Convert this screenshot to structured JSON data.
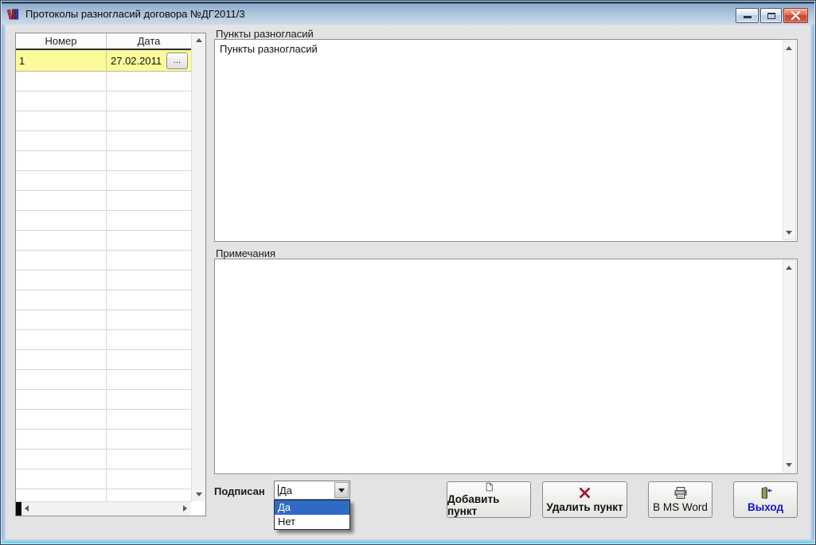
{
  "window": {
    "title": "Протоколы разногласий договора №ДГ2011/3"
  },
  "grid": {
    "columns": [
      "Номер",
      "Дата"
    ],
    "rows": [
      {
        "number": "1",
        "date": "27.02.2011"
      }
    ],
    "more_button": "...",
    "visible_empty_rows": 22
  },
  "sections": {
    "points": {
      "label": "Пункты разногласий",
      "content": "Пункты разногласий"
    },
    "notes": {
      "label": "Примечания",
      "content": ""
    }
  },
  "signed": {
    "label": "Подписан",
    "value": "Да",
    "options": [
      "Да",
      "Нет"
    ],
    "selected_option": "Да"
  },
  "buttons": {
    "add": "Добавить пункт",
    "delete": "Удалить пункт",
    "word": "В MS Word",
    "exit": "Выход"
  },
  "icons": {
    "app": "books-icon",
    "minimize": "minimize-icon",
    "maximize": "maximize-icon",
    "close": "close-icon",
    "add": "new-document-icon",
    "delete": "red-x-icon",
    "word": "printer-icon",
    "exit": "exit-door-icon",
    "combo": "chevron-down-icon"
  },
  "colors": {
    "selection_blue": "#2F6BC5",
    "row_highlight_yellow": "#FBFB9B",
    "close_button_red": "#D8604A",
    "exit_label_blue": "#1414D2",
    "delete_icon_red": "#9D1C30",
    "titlebar_blue": "#AFC7DE"
  }
}
